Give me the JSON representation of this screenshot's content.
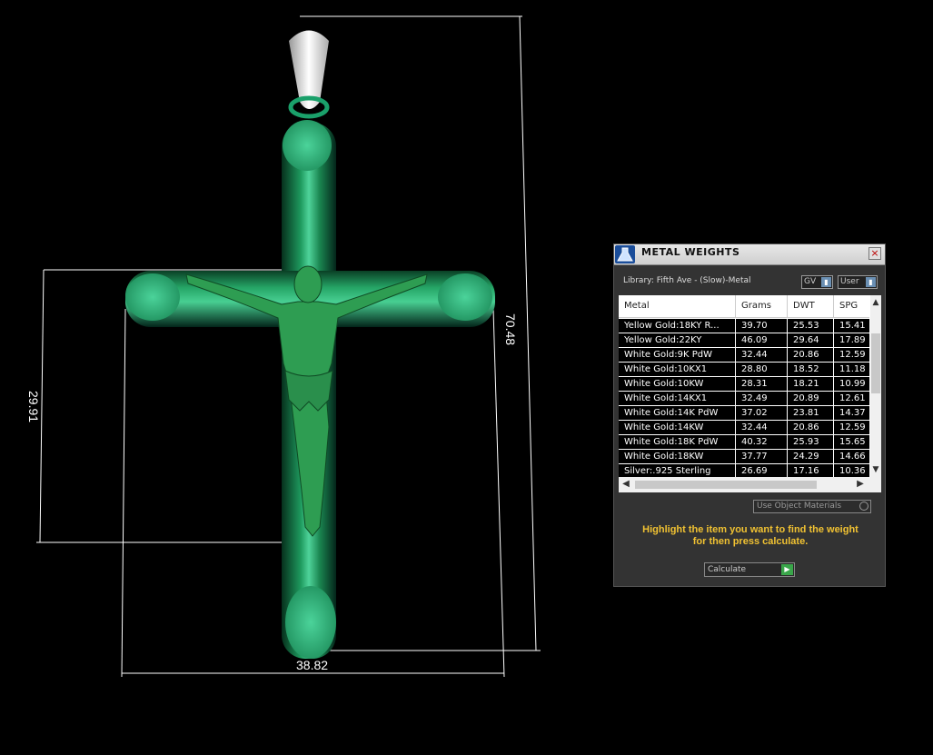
{
  "viewport": {
    "dim_height": "70.48",
    "dim_arm": "29.91",
    "dim_width": "38.82"
  },
  "panel": {
    "title": "METAL WEIGHTS",
    "close": "×",
    "library_label": "Library: Fifth Ave - (Slow)-Metal",
    "select_gv": "GV",
    "select_user": "User",
    "table": {
      "headers": [
        "Metal",
        "Grams",
        "DWT",
        "SPG"
      ],
      "rows": [
        {
          "metal": "Yellow Gold:18KY R...",
          "grams": "39.70",
          "dwt": "25.53",
          "spg": "15.41"
        },
        {
          "metal": "Yellow Gold:22KY",
          "grams": "46.09",
          "dwt": "29.64",
          "spg": "17.89"
        },
        {
          "metal": "White Gold:9K PdW",
          "grams": "32.44",
          "dwt": "20.86",
          "spg": "12.59"
        },
        {
          "metal": "White Gold:10KX1",
          "grams": "28.80",
          "dwt": "18.52",
          "spg": "11.18"
        },
        {
          "metal": "White Gold:10KW",
          "grams": "28.31",
          "dwt": "18.21",
          "spg": "10.99"
        },
        {
          "metal": "White Gold:14KX1",
          "grams": "32.49",
          "dwt": "20.89",
          "spg": "12.61"
        },
        {
          "metal": "White Gold:14K PdW",
          "grams": "37.02",
          "dwt": "23.81",
          "spg": "14.37"
        },
        {
          "metal": "White Gold:14KW",
          "grams": "32.44",
          "dwt": "20.86",
          "spg": "12.59"
        },
        {
          "metal": "White Gold:18K PdW",
          "grams": "40.32",
          "dwt": "25.93",
          "spg": "15.65"
        },
        {
          "metal": "White Gold:18KW",
          "grams": "37.77",
          "dwt": "24.29",
          "spg": "14.66"
        },
        {
          "metal": "Silver:.925 Sterling",
          "grams": "26.69",
          "dwt": "17.16",
          "spg": "10.36"
        }
      ]
    },
    "use_materials": "Use Object Materials",
    "hint_line1": "Highlight the item you want to find the weight",
    "hint_line2": "for then press calculate.",
    "calculate": "Calculate"
  }
}
